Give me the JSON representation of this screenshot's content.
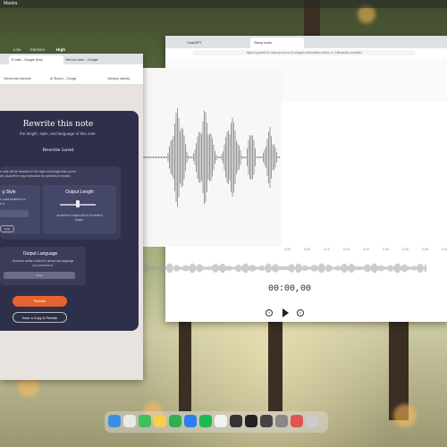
{
  "menubar": {
    "app": "Mastra"
  },
  "right_window": {
    "tabs": [
      {
        "label": "ChatGPT",
        "active": false
      },
      {
        "label": "Sleep tests",
        "active": true
      }
    ],
    "address": "https://quizlett.lt/ Laisvoji norma iš saugios tebeanfaro tolimo ir / Lithuanian doubled",
    "x_ticks": [
      "0,00",
      "0,05",
      "0,10",
      "0,15",
      "0,20",
      "0,25",
      "0,30",
      "0,35",
      "0,40"
    ],
    "timecode": "00:00,00"
  },
  "left_window": {
    "tabs": [
      {
        "label": "E-mail – Google Docs",
        "active": true
      },
      {
        "label": "Test pro rané – Google",
        "active": false
      }
    ],
    "bookmarks": [
      "Generování obrázků",
      "AI Škoení – Google",
      "Všechny záložky"
    ]
  },
  "modal": {
    "title": "Rewrite this note",
    "subtitle": "the length, style, and language of this note.",
    "level_heading": "Rewrite Level",
    "levels": [
      {
        "label": "Low",
        "selected": false
      },
      {
        "label": "Medium",
        "selected": false
      },
      {
        "label": "High",
        "selected": true
      }
    ],
    "info_line1": "e note will be rewritten in the style and length that you've",
    "info_line2": "ain, AudioPen may restructure its contents if needed.",
    "style_title": "g Style",
    "style_text1": "n, want AudioPen to",
    "style_text2": "e in",
    "style_button": "style",
    "length_title": "Output Length",
    "length_text1": "AudioPen's output will be of medium",
    "length_text2": "length.",
    "length_value": 0.5,
    "language_title": "Output Language",
    "language_text1": "Generate written content in almost any language",
    "language_text2": "you can think of.",
    "language_value": "Same",
    "rewrite_button": "Rewrite",
    "save_copy_button": "Save a Copy & Rewrite"
  },
  "dock": {
    "apps": [
      "finder-icon",
      "chrome-icon",
      "messages-icon",
      "notes-icon",
      "whatsapp-icon",
      "messenger-icon",
      "spotify-icon",
      "mail-icon",
      "finalcut-icon",
      "terminal-icon",
      "system-icon",
      "preferences-icon",
      "photos-icon",
      "trash-icon"
    ]
  },
  "colors": {
    "accent": "#e8622e",
    "modal_bg": "#2e2f4a",
    "cursor": "#5560d6"
  }
}
